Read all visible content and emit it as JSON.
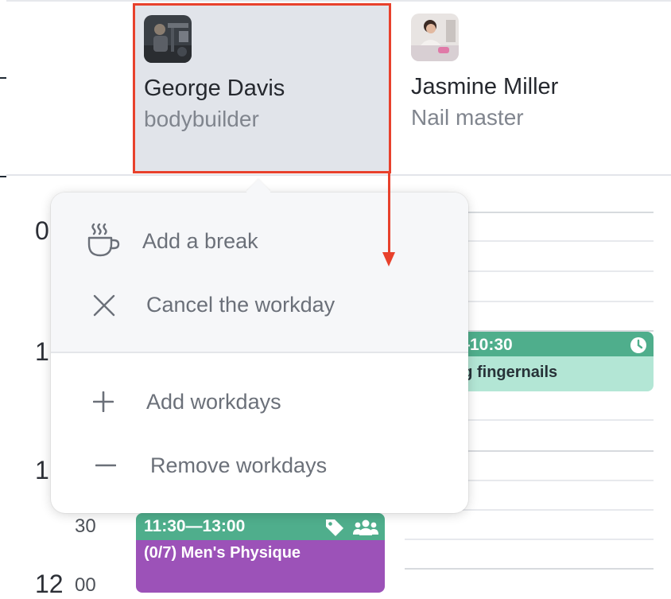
{
  "employees": [
    {
      "name": "George Davis",
      "role": "bodybuilder",
      "avatar_icon": "george-davis-avatar"
    },
    {
      "name": "Jasmine Miller",
      "role": "Nail master",
      "avatar_icon": "jasmine-miller-avatar"
    }
  ],
  "time_labels": [
    {
      "text": "0"
    },
    {
      "text": "1"
    },
    {
      "text": "1"
    },
    {
      "text": "30"
    },
    {
      "text": "12"
    },
    {
      "text": "00"
    }
  ],
  "context_menu": {
    "items": [
      {
        "label": "Add a break",
        "icon": "coffee-cup-icon"
      },
      {
        "label": "Cancel the workday",
        "icon": "close-icon"
      },
      {
        "label": "Add workdays",
        "icon": "plus-icon"
      },
      {
        "label": "Remove workdays",
        "icon": "minus-icon"
      }
    ]
  },
  "events": [
    {
      "time": "—10:30",
      "title": "ng fingernails",
      "icon": "clock-icon",
      "color": "#4fae8c",
      "body_color": "#b3e6d5"
    },
    {
      "time": "11:30—13:00",
      "title": "(0/7) Men's Physique",
      "icons": [
        "tag-icon",
        "group-icon"
      ],
      "color": "#4fae8c",
      "body_color": "#9c52b8"
    }
  ],
  "colors": {
    "highlight": "#e8412c",
    "selected_bg": "#e1e4ea"
  }
}
